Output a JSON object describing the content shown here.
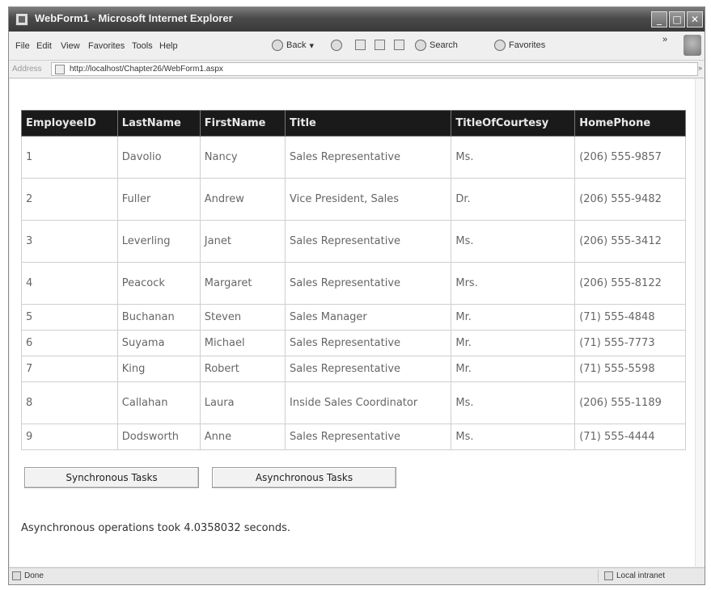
{
  "window": {
    "title": "WebForm1 - Microsoft Internet Explorer"
  },
  "window_controls": {
    "minimize": "_",
    "maximize": "□",
    "close": "✕"
  },
  "menu": [
    "File",
    "Edit",
    "View",
    "Favorites",
    "Tools",
    "Help"
  ],
  "toolbar": {
    "back": "Back",
    "search": "Search",
    "favorites": "Favorites"
  },
  "address": {
    "label": "Address",
    "url": "http://localhost/Chapter26/WebForm1.aspx"
  },
  "grid": {
    "headers": [
      "EmployeeID",
      "LastName",
      "FirstName",
      "Title",
      "TitleOfCourtesy",
      "HomePhone"
    ],
    "rows": [
      [
        "1",
        "Davolio",
        "Nancy",
        "Sales Representative",
        "Ms.",
        "(206) 555-9857"
      ],
      [
        "2",
        "Fuller",
        "Andrew",
        "Vice President, Sales",
        "Dr.",
        "(206) 555-9482"
      ],
      [
        "3",
        "Leverling",
        "Janet",
        "Sales Representative",
        "Ms.",
        "(206) 555-3412"
      ],
      [
        "4",
        "Peacock",
        "Margaret",
        "Sales Representative",
        "Mrs.",
        "(206) 555-8122"
      ],
      [
        "5",
        "Buchanan",
        "Steven",
        "Sales Manager",
        "Mr.",
        "(71) 555-4848"
      ],
      [
        "6",
        "Suyama",
        "Michael",
        "Sales Representative",
        "Mr.",
        "(71) 555-7773"
      ],
      [
        "7",
        "King",
        "Robert",
        "Sales Representative",
        "Mr.",
        "(71) 555-5598"
      ],
      [
        "8",
        "Callahan",
        "Laura",
        "Inside Sales Coordinator",
        "Ms.",
        "(206) 555-1189"
      ],
      [
        "9",
        "Dodsworth",
        "Anne",
        "Sales Representative",
        "Ms.",
        "(71) 555-4444"
      ]
    ]
  },
  "buttons": {
    "sync": "Synchronous Tasks",
    "async": "Asynchronous Tasks"
  },
  "result": {
    "text": "Asynchronous operations took 4.0358032 seconds."
  },
  "status": {
    "left": "Done",
    "right": "Local intranet"
  }
}
